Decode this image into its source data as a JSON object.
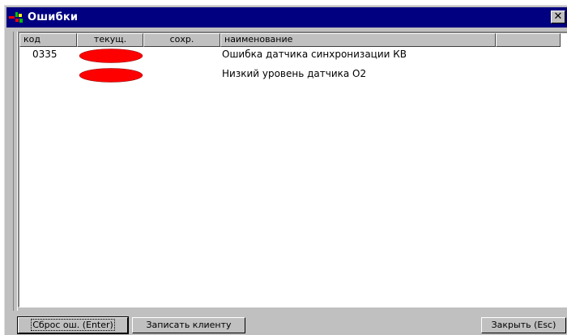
{
  "window": {
    "title": "Ошибки",
    "close_glyph": "✕",
    "title_icon": "app-icon",
    "colors": {
      "titlebar": "#000080",
      "face": "#c0c0c0",
      "led_red": "#ff0000"
    }
  },
  "table": {
    "columns": [
      "код",
      "текущ.",
      "сохр.",
      "наименование",
      ""
    ],
    "rows": [
      {
        "code": "0335",
        "current": "red-indicator",
        "saved": "",
        "name": "Ошибка датчика синхронизации КВ"
      },
      {
        "code": "",
        "current": "red-indicator",
        "saved": "",
        "name": "Низкий уровень датчика O2"
      }
    ]
  },
  "buttons": {
    "reset": "Сброс ош. (Enter)",
    "write_client": "Записать клиенту",
    "close": "Закрыть (Esc)"
  }
}
